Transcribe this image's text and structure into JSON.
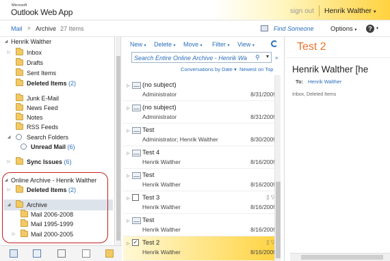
{
  "header": {
    "brand_small": "Microsoft",
    "brand": "Outlook Web App",
    "sign_out": "sign out",
    "user": "Henrik Walther",
    "user_caret": "▾"
  },
  "breadcrumb": {
    "mail": "Mail",
    "separator": ">",
    "current": "Archive",
    "count": "27 Items",
    "find_someone": "Find Someone",
    "options": "Options",
    "options_caret": "▾",
    "help": "?",
    "help_caret": "▾"
  },
  "folders": {
    "mailbox_name": "Henrik Walther",
    "items": [
      {
        "name": "Inbox",
        "count": ""
      },
      {
        "name": "Drafts",
        "count": ""
      },
      {
        "name": "Sent Items",
        "count": ""
      },
      {
        "name": "Deleted Items",
        "count": "(2)"
      },
      {
        "name": "Junk E-Mail",
        "count": ""
      },
      {
        "name": "News Feed",
        "count": ""
      },
      {
        "name": "Notes",
        "count": ""
      },
      {
        "name": "RSS Feeds",
        "count": ""
      },
      {
        "name": "Search Folders",
        "count": ""
      },
      {
        "name": "Unread Mail",
        "count": "(6)"
      },
      {
        "name": "Sync Issues",
        "count": "(6)"
      }
    ],
    "archive_name": "Online Archive - Henrik Walther",
    "archive_items": [
      {
        "name": "Deleted Items",
        "count": "(2)"
      },
      {
        "name": "Archive",
        "count": ""
      },
      {
        "name": "Mail 2006-2008",
        "count": ""
      },
      {
        "name": "Mail 1995-1999",
        "count": ""
      },
      {
        "name": "Mail 2000-2005",
        "count": ""
      }
    ]
  },
  "bottom_nav": [
    "mail-icon",
    "calendar-icon",
    "contacts-icon",
    "tasks-icon",
    "public-folders-icon"
  ],
  "toolbar": {
    "new": "New",
    "delete": "Delete",
    "move": "Move",
    "filter": "Filter",
    "view": "View",
    "caret": "▾"
  },
  "search": {
    "placeholder": "Search Entire Online Archive - Henrik Wa"
  },
  "sort": {
    "conversations": "Conversations by Date ▾",
    "newest": "Newest on Top"
  },
  "messages": [
    {
      "subject": "(no subject)",
      "from": "Administrator",
      "date": "8/31/2009"
    },
    {
      "subject": "(no subject)",
      "from": "Administrator",
      "date": "8/31/2009"
    },
    {
      "subject": "Test",
      "from": "Administrator; Henrik Walther",
      "date": "8/30/2009"
    },
    {
      "subject": "Test 4",
      "from": "Henrik Walther",
      "date": "8/16/2009"
    },
    {
      "subject": "Test",
      "from": "Henrik Walther",
      "date": "8/16/2009"
    },
    {
      "subject": "Test 3",
      "from": "Henrik Walther",
      "date": "8/16/2009"
    },
    {
      "subject": "Test",
      "from": "Henrik Walther",
      "date": "8/16/2009"
    },
    {
      "subject": "Test 2",
      "from": "Henrik Walther",
      "date": "8/16/2009"
    }
  ],
  "reading": {
    "title": "Test 2",
    "from": "Henrik Walther [he",
    "to_label": "To:",
    "to": "Henrik Walther",
    "folder": "Inbox, Deleted Items"
  },
  "colors": {
    "accent_link": "#2a6ebc",
    "title_orange": "#e8742a",
    "header_gold": "#ffd23f",
    "annotation_red": "#c21c1c"
  }
}
